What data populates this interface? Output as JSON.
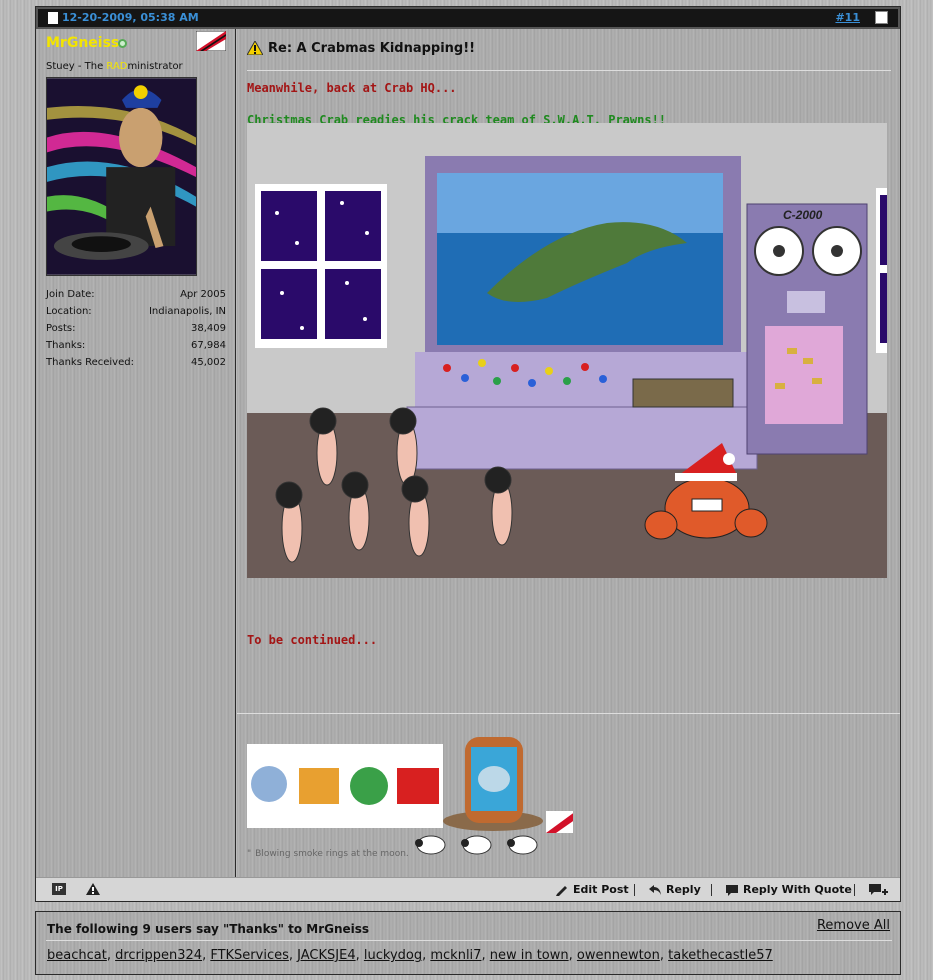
{
  "post": {
    "date": "12-20-2009, 05:38 AM",
    "number": "#11",
    "username": "MrGneiss",
    "usertitle_prefix": "Stuey - The ",
    "usertitle_highlight": "RAD",
    "usertitle_suffix": "ministrator",
    "stats": [
      {
        "label": "Join Date:",
        "value": "Apr 2005"
      },
      {
        "label": "Location:",
        "value": "Indianapolis, IN"
      },
      {
        "label": "Posts:",
        "value": "38,409"
      },
      {
        "label": "Thanks:",
        "value": "67,984"
      },
      {
        "label": "Thanks Received:",
        "value": "45,002"
      }
    ],
    "title": "Re: A Crabmas Kidnapping!!",
    "line1": "Meanwhile, back at Crab HQ...",
    "line2": "Christmas Crab readies his crack team of S.W.A.T. Prawns!!",
    "line3": "To be continued...",
    "scene_machine_label": "C-2000",
    "signature_quote": "Blowing smoke rings at the moon.",
    "signature_quote_mark": "\""
  },
  "footer": {
    "ip_label": "IP",
    "edit_label": "Edit Post",
    "reply_label": "Reply",
    "reply_quote_label": "Reply With Quote"
  },
  "thanks": {
    "title": "The following 9 users say \"Thanks\" to MrGneiss",
    "remove_all": "Remove All",
    "users": [
      "beachcat",
      "drcrippen324",
      "FTKServices",
      "JACKSJE4",
      "luckydog",
      "mcknli7",
      "new in town",
      "owennewton",
      "takethecastle57"
    ]
  },
  "colors": {
    "username": "#f3e500",
    "msg_red": "#a31515",
    "msg_green": "#1f8a1f",
    "header_link": "#3a8fd6"
  }
}
